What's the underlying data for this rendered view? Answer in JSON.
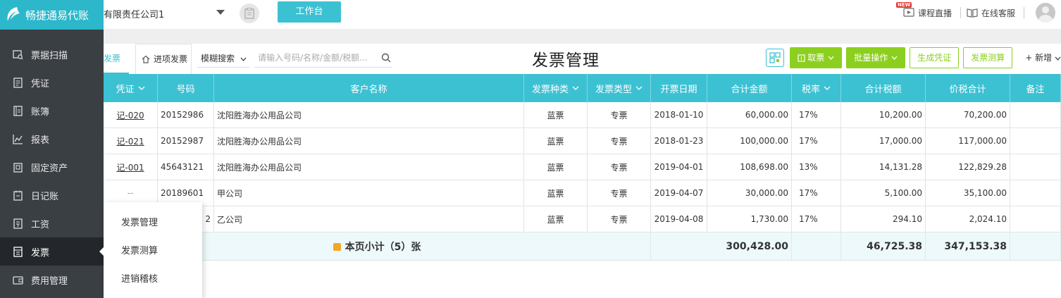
{
  "app": {
    "logo_text": "畅捷通易代账",
    "company": "有限责任公司1",
    "workbench_label": "工作台"
  },
  "topbar": {
    "new_badge": "NEW",
    "course_live": "课程直播",
    "online_service": "在线客服"
  },
  "sidebar": {
    "items": [
      {
        "label": "票据扫描",
        "icon": "scan-icon"
      },
      {
        "label": "凭证",
        "icon": "voucher-icon"
      },
      {
        "label": "账簿",
        "icon": "ledger-icon"
      },
      {
        "label": "报表",
        "icon": "report-chart-icon"
      },
      {
        "label": "固定资产",
        "icon": "fixed-asset-icon"
      },
      {
        "label": "日记账",
        "icon": "journal-icon"
      },
      {
        "label": "工资",
        "icon": "salary-icon"
      },
      {
        "label": "发票",
        "icon": "invoice-icon",
        "active": true
      },
      {
        "label": "费用管理",
        "icon": "expense-icon"
      }
    ]
  },
  "submenu": {
    "items": [
      "发票管理",
      "发票测算",
      "进销稽核"
    ]
  },
  "toolbar": {
    "tab_sales": "发票",
    "tab_purchase": "进项发票",
    "fuzzy_search": "模糊搜索",
    "search_placeholder": "请输入号码/名称/金额/税额...",
    "page_title": "发票管理",
    "fetch_invoice": "取票",
    "batch_ops": "批量操作",
    "generate_voucher": "生成凭证",
    "invoice_calc": "发票测算",
    "add_new": "+ 新增"
  },
  "table": {
    "headers": [
      "凭证",
      "号码",
      "客户名称",
      "发票种类",
      "发票类型",
      "开票日期",
      "合计金额",
      "税率",
      "合计税额",
      "价税合计",
      "备注"
    ],
    "rows": [
      {
        "voucher": "记-020",
        "number": "20152986",
        "customer": "沈阳胜海办公用品公司",
        "kind": "蓝票",
        "type": "专票",
        "date": "2018-01-10",
        "amount": "60,000.00",
        "rate": "17%",
        "tax": "10,200.00",
        "total": "70,200.00",
        "remark": ""
      },
      {
        "voucher": "记-021",
        "number": "20152987",
        "customer": "沈阳胜海办公用品公司",
        "kind": "蓝票",
        "type": "专票",
        "date": "2018-01-23",
        "amount": "100,000.00",
        "rate": "17%",
        "tax": "17,000.00",
        "total": "117,000.00",
        "remark": ""
      },
      {
        "voucher": "记-001",
        "number": "45643121",
        "customer": "沈阳胜海办公用品公司",
        "kind": "蓝票",
        "type": "专票",
        "date": "2019-04-01",
        "amount": "108,698.00",
        "rate": "13%",
        "tax": "14,131.28",
        "total": "122,829.28",
        "remark": ""
      },
      {
        "voucher": "--",
        "number": "20189601",
        "customer": "甲公司",
        "kind": "蓝票",
        "type": "专票",
        "date": "2019-04-07",
        "amount": "30,000.00",
        "rate": "17%",
        "tax": "5,100.00",
        "total": "35,100.00",
        "remark": ""
      },
      {
        "voucher": "",
        "number": "2",
        "customer": "乙公司",
        "kind": "蓝票",
        "type": "专票",
        "date": "2019-04-08",
        "amount": "1,730.00",
        "rate": "17%",
        "tax": "294.10",
        "total": "2,024.10",
        "remark": ""
      }
    ],
    "subtotal": {
      "label": "本页小计（5）张",
      "amount": "300,428.00",
      "tax": "46,725.38",
      "total": "347,153.38"
    }
  },
  "colors": {
    "accent": "#3cc1d3",
    "sidebar_bg": "#3a3f44",
    "green": "#8ccf1f"
  }
}
